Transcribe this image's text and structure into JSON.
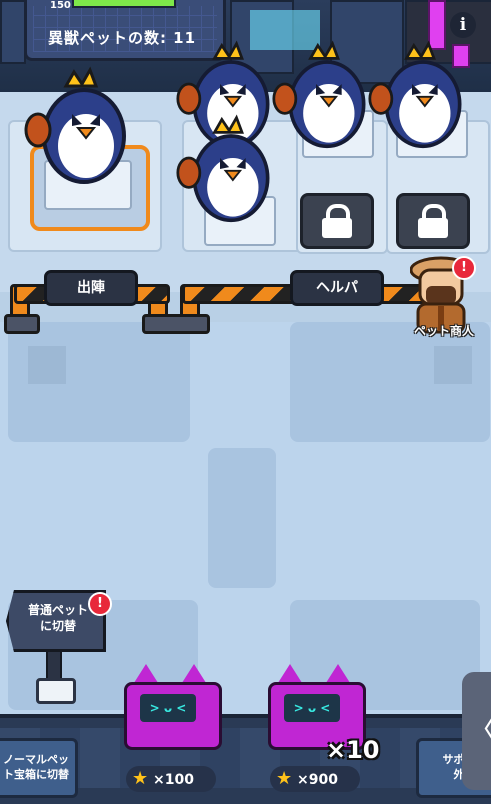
{
  "header": {
    "small_value": "150",
    "pet_count_label": "異獣ペットの数: 11"
  },
  "info_icon": "i",
  "signs": {
    "deploy": "出陣",
    "helper": "ヘルパ"
  },
  "merchant": {
    "label": "ペット商人",
    "alert": "!"
  },
  "switch_sign": {
    "line1": "普通ペット",
    "line2": "に切替",
    "alert": "!"
  },
  "bottom": {
    "left_button_line1": "ノーマルペッ",
    "left_button_line2": "ト宝箱に切替",
    "right_button_line1": "サポー",
    "right_button_line2": "外",
    "chest1_price": "×100",
    "chest2_price": "×900",
    "chest2_multiplier": "×10",
    "side_tab_glyph": "〈"
  },
  "colors": {
    "accent_orange": "#f08a1c",
    "chest_magenta": "#c026d3",
    "alert_red": "#e8283a"
  }
}
